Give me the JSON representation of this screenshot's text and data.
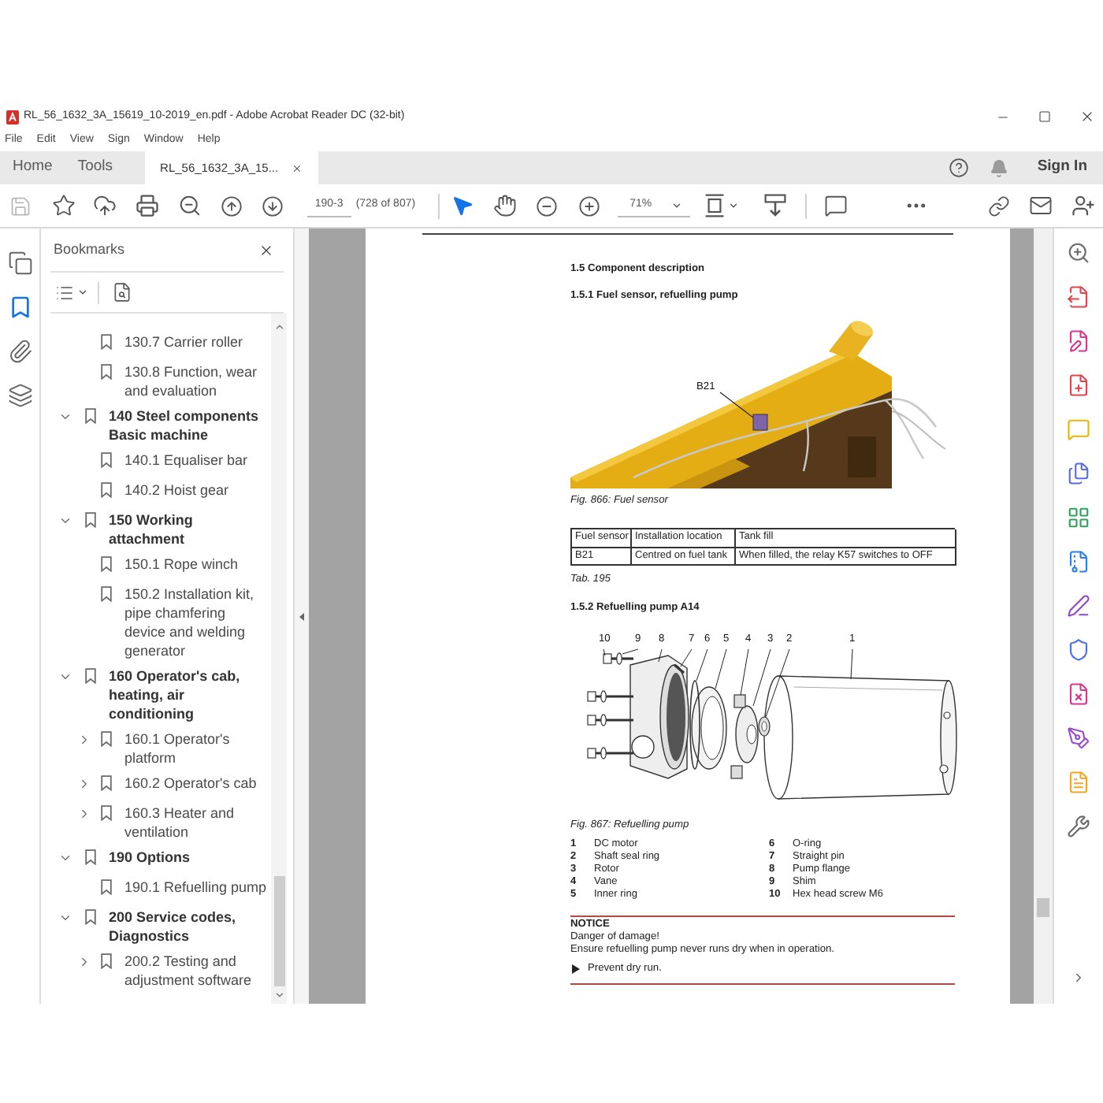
{
  "window": {
    "title": "RL_56_1632_3A_15619_10-2019_en.pdf - Adobe Acrobat Reader DC (32-bit)"
  },
  "menu": [
    "File",
    "Edit",
    "View",
    "Sign",
    "Window",
    "Help"
  ],
  "tabs": [
    {
      "label": "Home",
      "selected": false
    },
    {
      "label": "Tools",
      "selected": false
    },
    {
      "label": "RL_56_1632_3A_15...",
      "selected": true
    }
  ],
  "account": {
    "sign_in": "Sign In"
  },
  "toolbar": {
    "save": {
      "disabled": true
    },
    "page_field": {
      "value": "190-3"
    },
    "page_count": "(728 of 807)",
    "tools": [
      {
        "kind": "select",
        "selected": true
      },
      {
        "kind": "hand",
        "selected": false
      }
    ],
    "zoom_field": {
      "value": "71%"
    }
  },
  "nav_panel": [
    {
      "kind": "pages",
      "selected": false
    },
    {
      "kind": "bookmarks",
      "selected": true
    },
    {
      "kind": "attachments",
      "selected": false
    },
    {
      "kind": "layers",
      "selected": false
    }
  ],
  "bookmarks": {
    "title": "Bookmarks",
    "partial_group": [
      {
        "label": "130.7 Carrier roller"
      },
      {
        "label": "130.8 Function, wear and evaluation"
      }
    ],
    "items": [
      {
        "label": "140 Steel components Basic machine",
        "expanded": true,
        "children": [
          {
            "label": "140.1 Equaliser bar"
          },
          {
            "label": "140.2 Hoist gear"
          }
        ]
      },
      {
        "label": "150 Working attachment",
        "expanded": true,
        "children": [
          {
            "label": "150.1 Rope winch"
          },
          {
            "label": "150.2 Installation kit, pipe chamfering device and welding generator"
          }
        ]
      },
      {
        "label": "160 Operator's cab, heating, air conditioning",
        "expanded": true,
        "children": [
          {
            "label": "160.1 Operator's platform",
            "expanded": false
          },
          {
            "label": "160.2 Operator's cab",
            "expanded": false
          },
          {
            "label": "160.3 Heater and ventilation",
            "expanded": false
          }
        ]
      },
      {
        "label": "190 Options",
        "expanded": true,
        "children": [
          {
            "label": "190.1 Refuelling pump"
          }
        ]
      },
      {
        "label": "200 Service codes, Diagnostics",
        "expanded": true,
        "children": [
          {
            "label": "200.2 Testing and adjustment software",
            "expanded": false
          }
        ]
      }
    ]
  },
  "page": {
    "heading": "1.5 Component description",
    "fuel_sensor": {
      "heading": "1.5.1 Fuel sensor, refuelling pump",
      "callouts": [
        "B21"
      ],
      "caption": "Fig. 866: Fuel sensor",
      "table": {
        "columns": [
          "Fuel sensor",
          "Installation location",
          "Tank fill"
        ],
        "rows": [
          [
            "B21",
            "Centred on fuel tank",
            "When filled, the relay K57 switches to OFF"
          ]
        ]
      },
      "table_caption": "Tab. 195"
    },
    "refuelling_pump": {
      "heading": "1.5.2 Refuelling pump A14",
      "callouts": [
        "10",
        "9",
        "8",
        "7",
        "6",
        "5",
        "4",
        "3",
        "2",
        "1"
      ],
      "caption": "Fig. 867: Refuelling pump",
      "legend": [
        {
          "number": "1",
          "label": "DC motor"
        },
        {
          "number": "2",
          "label": "Shaft seal ring"
        },
        {
          "number": "3",
          "label": "Rotor"
        },
        {
          "number": "4",
          "label": "Vane"
        },
        {
          "number": "5",
          "label": "Inner ring"
        },
        {
          "number": "6",
          "label": "O-ring"
        },
        {
          "number": "7",
          "label": "Straight pin"
        },
        {
          "number": "8",
          "label": "Pump flange"
        },
        {
          "number": "9",
          "label": "Shim"
        },
        {
          "number": "10",
          "label": "Hex head screw M6"
        }
      ]
    },
    "notice": {
      "title": "NOTICE",
      "lines": [
        "Danger of damage!",
        "Ensure refuelling pump never runs dry when in operation."
      ],
      "steps": [
        "Prevent dry run."
      ]
    }
  }
}
